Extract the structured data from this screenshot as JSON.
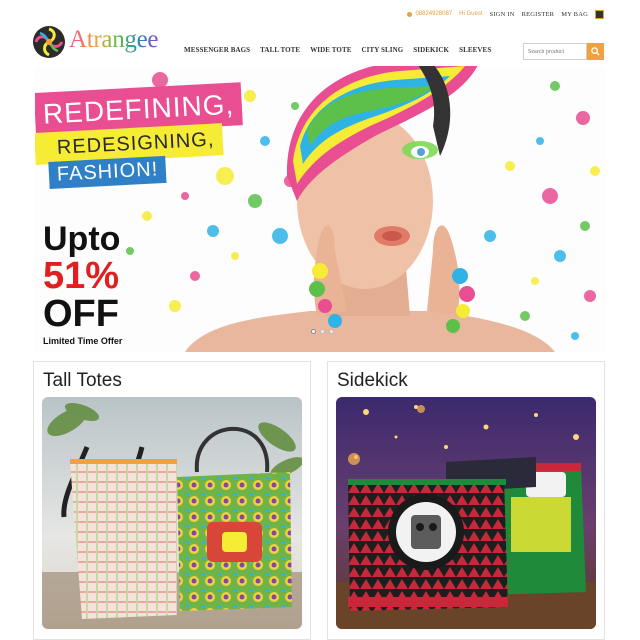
{
  "topbar": {
    "phone": "08824928087",
    "welcome": "Hi Guest",
    "signin": "SIGN IN",
    "register": "REGISTER",
    "bag": "MY BAG"
  },
  "logo": {
    "text": "Atrangee"
  },
  "nav": {
    "items": [
      {
        "label": "MESSENGER BAGS"
      },
      {
        "label": "TALL TOTE"
      },
      {
        "label": "WIDE TOTE"
      },
      {
        "label": "CITY SLING"
      },
      {
        "label": "SIDEKICK"
      },
      {
        "label": "SLEEVES"
      }
    ]
  },
  "search": {
    "placeholder": "Search product"
  },
  "hero": {
    "tag1": "REDEFINING,",
    "tag2": "REDESIGNING,",
    "tag3": "FASHION!",
    "offer_line1": "Upto",
    "offer_line2": "51%",
    "offer_line3": "OFF",
    "offer_note": "Limited Time Offer",
    "slides": 3,
    "active_slide": 1
  },
  "categories": [
    {
      "title": "Tall Totes"
    },
    {
      "title": "Sidekick"
    }
  ],
  "colors": {
    "accent": "#f2a23c",
    "pink": "#e94d92",
    "yellow": "#f6ec35",
    "blue": "#2f80c6",
    "offer_red": "#e02020"
  }
}
